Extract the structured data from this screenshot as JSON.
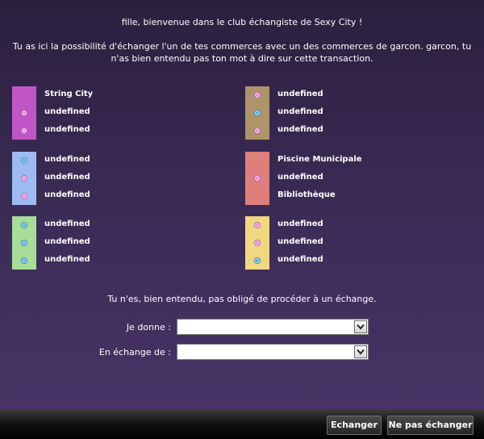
{
  "header": {
    "welcome": "fille, bienvenue dans le club échangiste de Sexy City !",
    "explanation": "Tu as ici la possibilité d'échanger l'un de tes commerces avec un des commerces de garcon. garcon, tu n'as bien entendu pas ton mot à dire sur cette transaction."
  },
  "left_groups": [
    {
      "color": "#c055c6",
      "items": [
        {
          "label": "String City",
          "dot": "none"
        },
        {
          "label": "undefined",
          "dot": "pink"
        },
        {
          "label": "undefined",
          "dot": "pink"
        }
      ]
    },
    {
      "color": "#9dbbf0",
      "items": [
        {
          "label": "undefined",
          "dot": "blue"
        },
        {
          "label": "undefined",
          "dot": "pink"
        },
        {
          "label": "undefined",
          "dot": "pink"
        }
      ]
    },
    {
      "color": "#a8dd98",
      "items": [
        {
          "label": "undefined",
          "dot": "blue"
        },
        {
          "label": "undefined",
          "dot": "blue"
        },
        {
          "label": "undefined",
          "dot": "blue"
        }
      ]
    }
  ],
  "right_groups": [
    {
      "color": "#ae9468",
      "items": [
        {
          "label": "undefined",
          "dot": "pink"
        },
        {
          "label": "undefined",
          "dot": "blue"
        },
        {
          "label": "undefined",
          "dot": "pink"
        }
      ]
    },
    {
      "color": "#df7f7b",
      "items": [
        {
          "label": "Piscine Municipale",
          "dot": "none"
        },
        {
          "label": "undefined",
          "dot": "pink"
        },
        {
          "label": "Bibliothèque",
          "dot": "none"
        }
      ]
    },
    {
      "color": "#efd880",
      "items": [
        {
          "label": "undefined",
          "dot": "pink"
        },
        {
          "label": "undefined",
          "dot": "pink"
        },
        {
          "label": "undefined",
          "dot": "blue"
        }
      ]
    }
  ],
  "form": {
    "notice": "Tu n'es, bien entendu, pas obligé de procéder à un échange.",
    "give_label": "Je donne :",
    "give_value": "",
    "receive_label": "En échange de :",
    "receive_value": ""
  },
  "footer": {
    "exchange_label": "Echanger",
    "no_exchange_label": "Ne pas échanger"
  },
  "icons": {
    "select_arrow": "chevron-down-icon",
    "pink_marker": "pink-dot-icon",
    "blue_marker": "blue-dot-icon"
  }
}
